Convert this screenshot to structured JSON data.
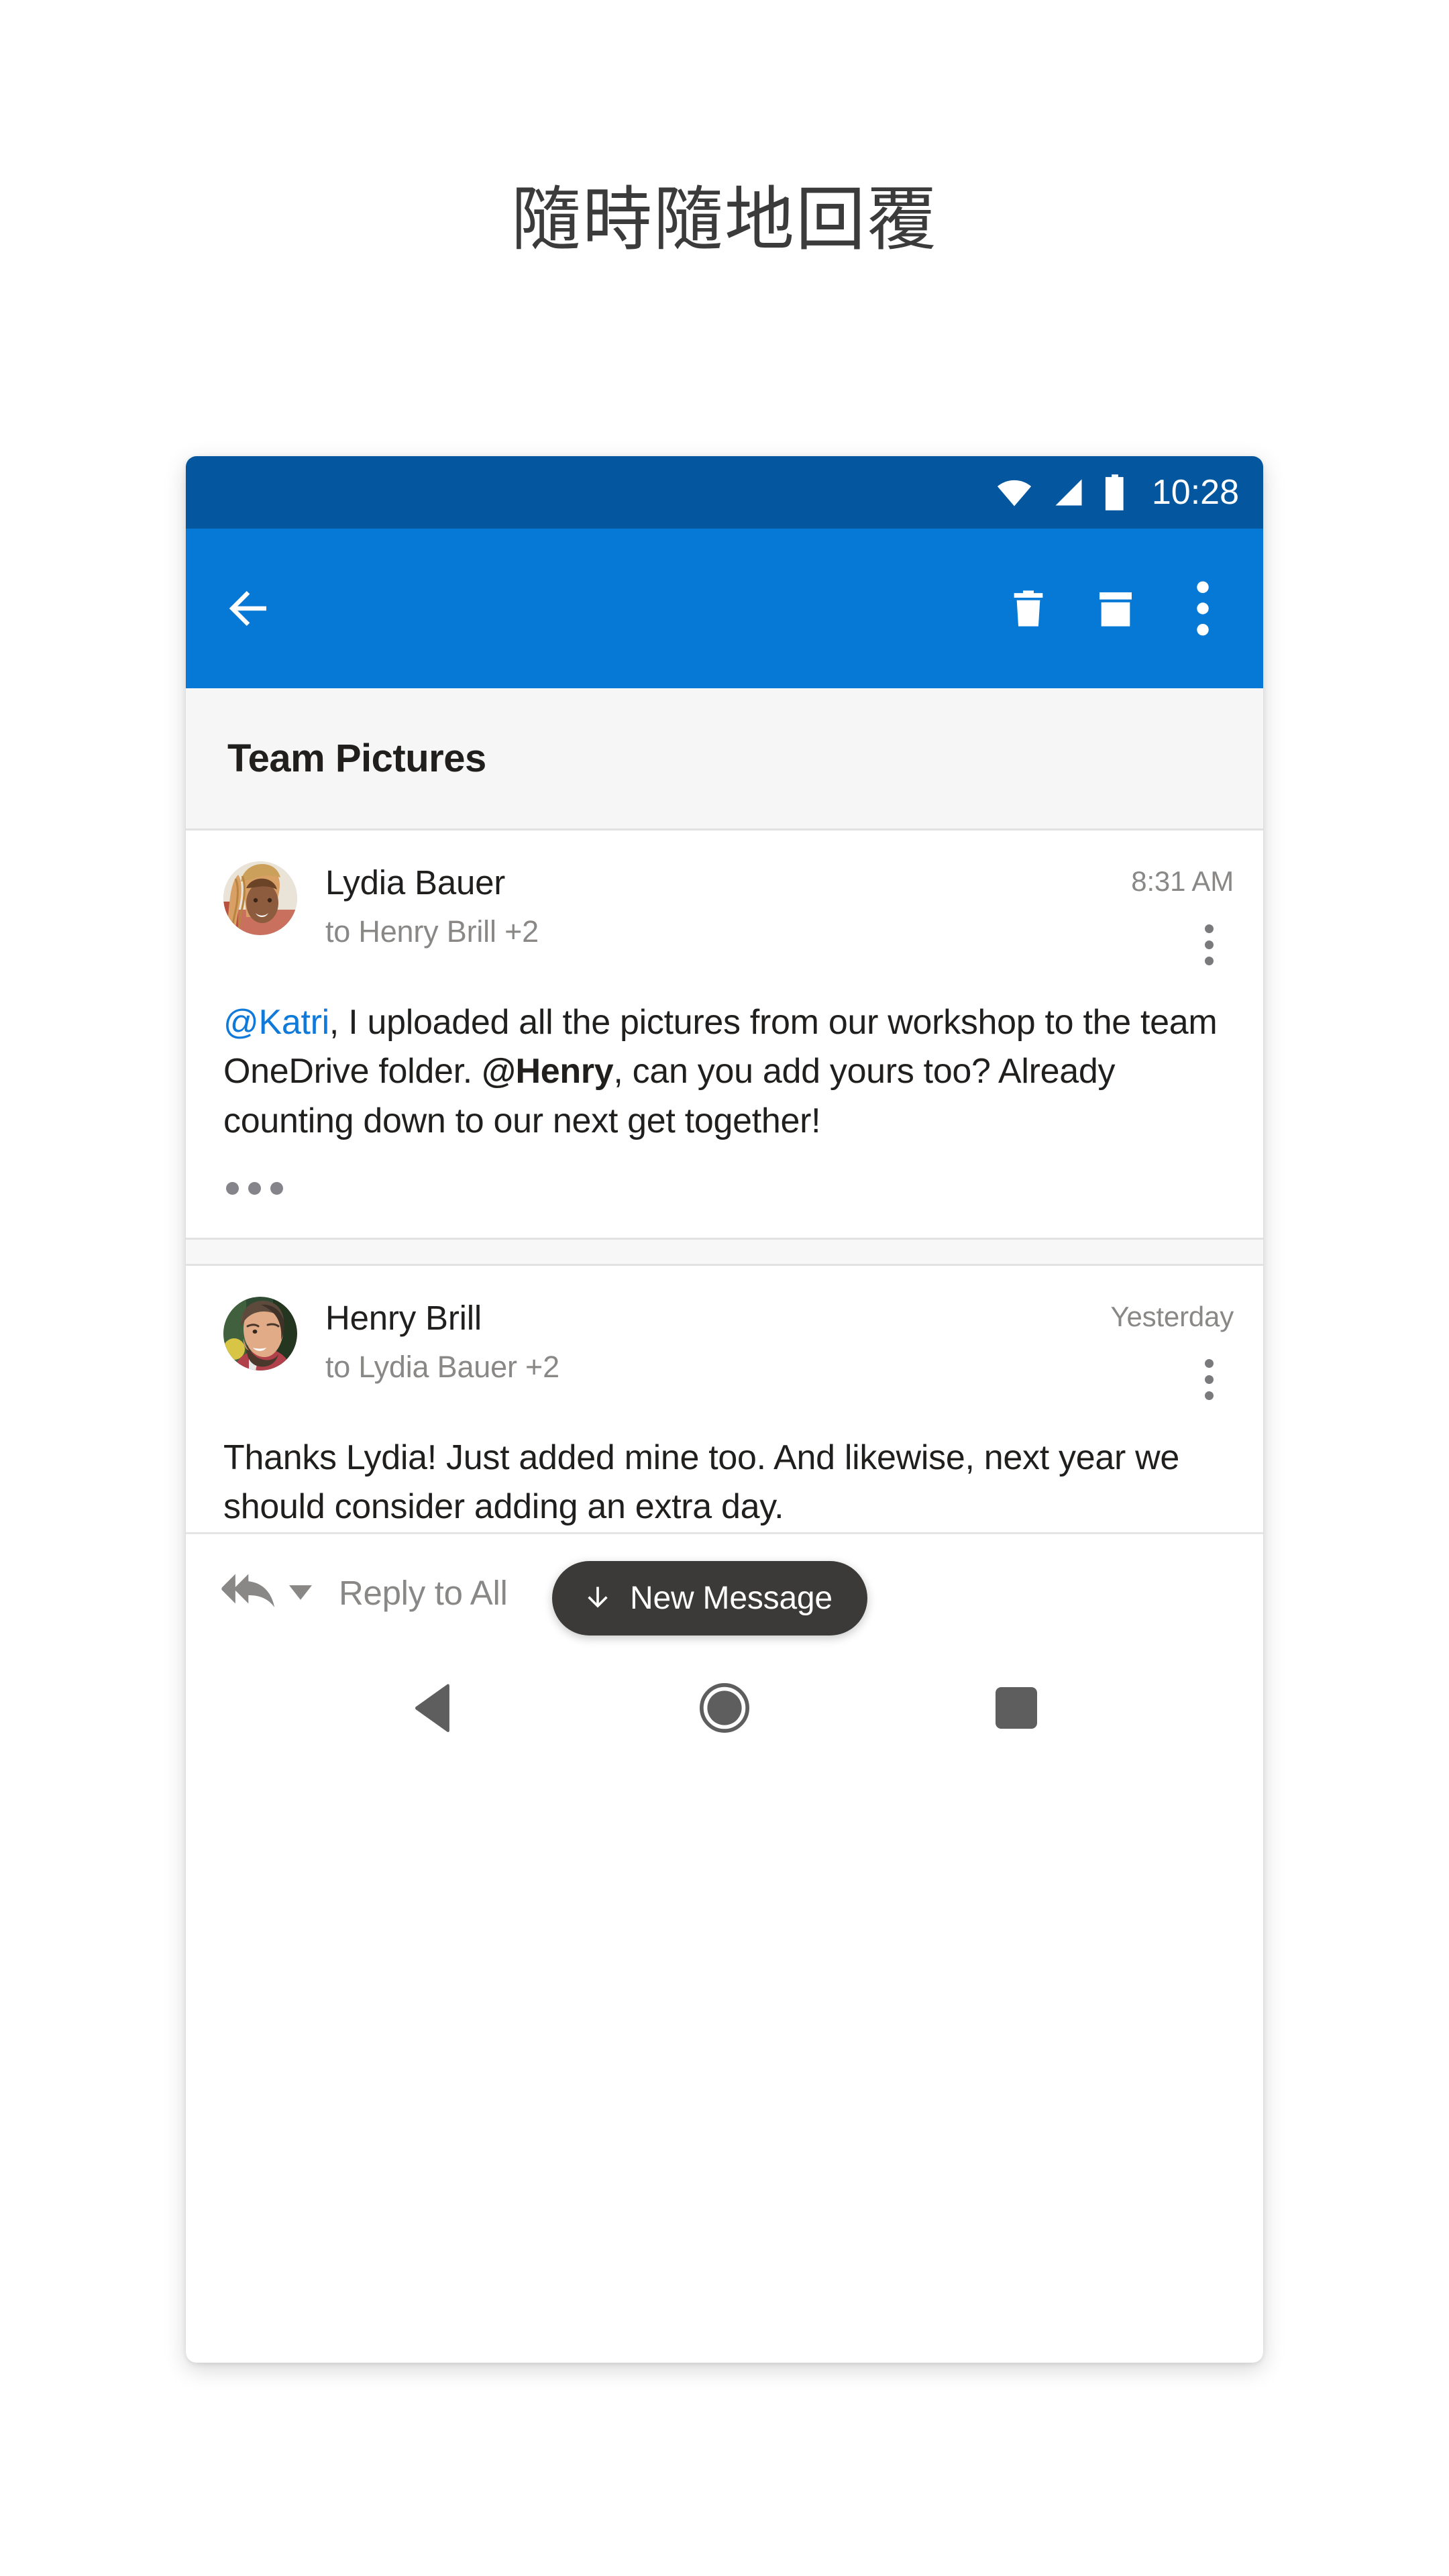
{
  "headline": "隨時隨地回覆",
  "statusbar": {
    "time": "10:28",
    "icons": [
      "wifi-icon",
      "cellular-signal-icon",
      "battery-icon"
    ],
    "background_color": "#04569f"
  },
  "appbar": {
    "background_color": "#0679d6",
    "back_label": "back-arrow-icon",
    "actions": [
      {
        "name": "delete-icon",
        "label": "Delete"
      },
      {
        "name": "archive-icon",
        "label": "Archive"
      },
      {
        "name": "more-options-icon",
        "label": "More options"
      }
    ]
  },
  "conversation": {
    "subject": "Team Pictures",
    "messages": [
      {
        "sender": "Lydia Bauer",
        "recipients": "to Henry Brill +2",
        "time": "8:31 AM",
        "avatar": "lydia-bauer-photo",
        "body_parts": [
          {
            "text": "@Katri",
            "style": "mention-link"
          },
          {
            "text": ", I uploaded all the pictures from our workshop to the team OneDrive folder. ",
            "style": "plain"
          },
          {
            "text": "@Henry",
            "style": "mention-bold"
          },
          {
            "text": ", can you add yours too? Already counting down to our next get together!",
            "style": "plain"
          }
        ],
        "trimmed_indicator": "show-trimmed-content"
      },
      {
        "sender": "Henry Brill",
        "recipients": "to Lydia Bauer +2",
        "time": "Yesterday",
        "avatar": "henry-brill-photo",
        "body_parts": [
          {
            "text": "Thanks Lydia! Just added mine too. And likewise, next year we should consider adding an extra day.",
            "style": "plain"
          }
        ]
      }
    ]
  },
  "new_message_pill": {
    "label": "New Message",
    "icon": "arrow-down-icon",
    "background_color": "#3b3a39"
  },
  "reply_bar": {
    "label": "Reply to All",
    "icon": "reply-all-icon",
    "caret": "chevron-down-icon"
  },
  "navbar": {
    "back": "android-back-icon",
    "home": "android-home-icon",
    "recents": "android-recents-icon"
  },
  "colors": {
    "status_blue": "#04569f",
    "app_blue": "#0679d6",
    "accent_link": "#0f7ad9",
    "text_primary": "#201f1e",
    "text_secondary": "#8a8886",
    "pill_dark": "#3b3a39"
  }
}
